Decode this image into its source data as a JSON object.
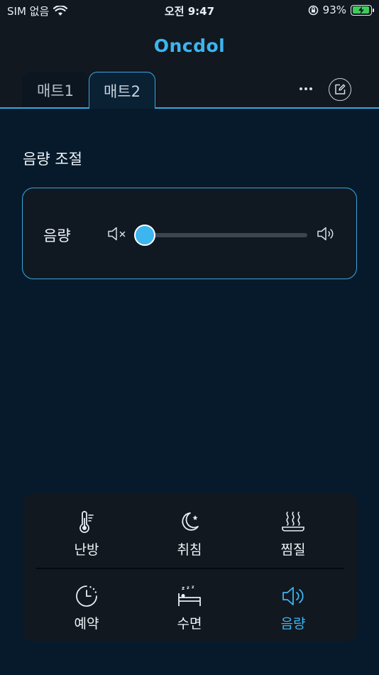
{
  "status_bar": {
    "carrier": "SIM 없음",
    "time": "오전 9:47",
    "battery": "93%",
    "battery_level": 0.93
  },
  "header": {
    "logo": "Oncdol",
    "tabs": [
      {
        "label": "매트1"
      },
      {
        "label": "매트2",
        "active": true
      }
    ]
  },
  "main": {
    "section_title": "음량 조절",
    "volume": {
      "label": "음량",
      "level": 0
    }
  },
  "bottom_menu": {
    "items": [
      {
        "label": "난방",
        "icon": "thermometer-icon"
      },
      {
        "label": "취침",
        "icon": "moon-star-icon"
      },
      {
        "label": "찜질",
        "icon": "steam-icon"
      },
      {
        "label": "예약",
        "icon": "timer-icon"
      },
      {
        "label": "수면",
        "icon": "sleep-bed-icon"
      },
      {
        "label": "음량",
        "icon": "speaker-icon",
        "active": true
      }
    ]
  },
  "colors": {
    "accent": "#3db5ef",
    "background": "#061a2b",
    "panel": "#111820"
  }
}
